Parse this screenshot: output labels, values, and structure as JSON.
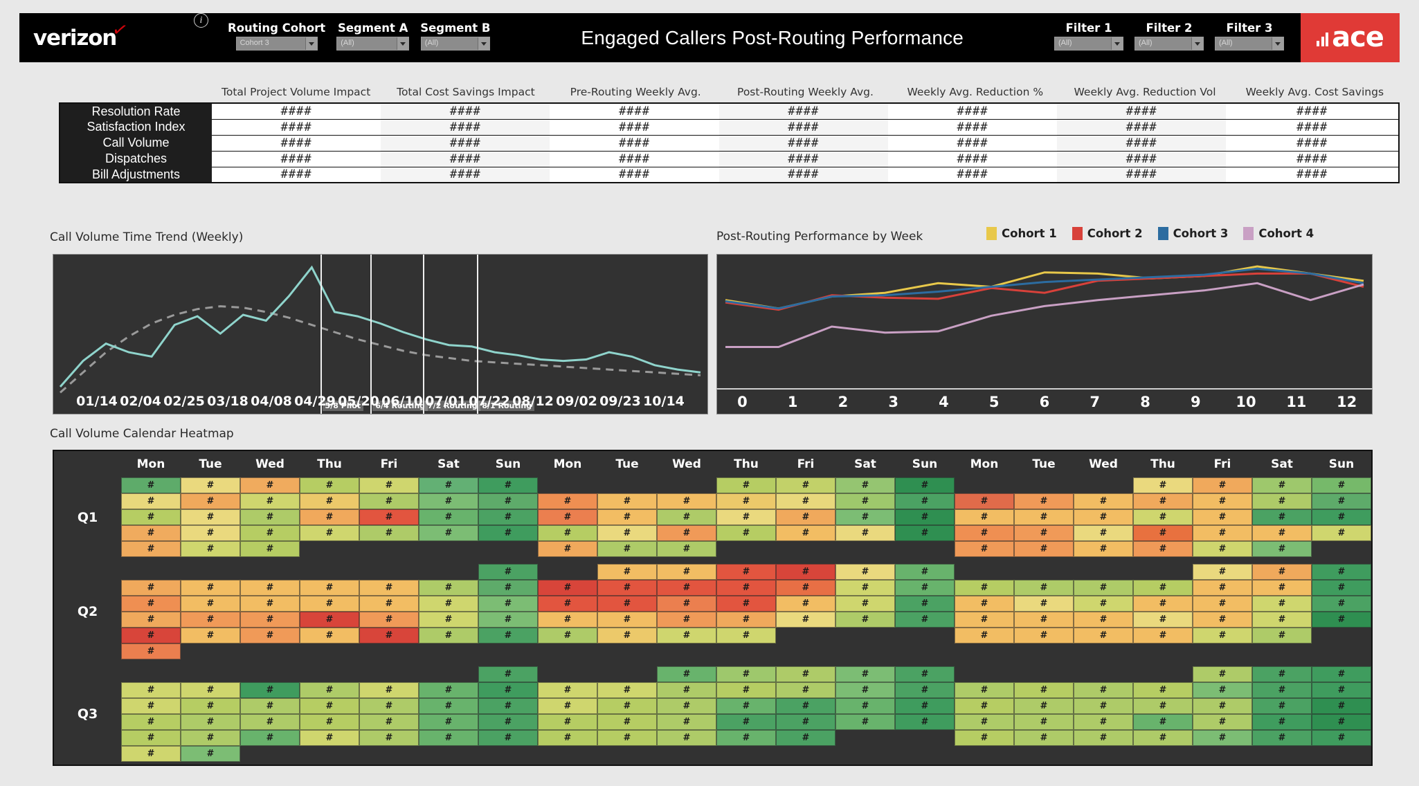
{
  "header": {
    "brand": "verizon",
    "brand_check": "✓",
    "info_icon": "info-icon",
    "title": "Engaged Callers Post-Routing Performance",
    "ace_logo_text": "ace",
    "left_filters": [
      {
        "label": "Routing Cohort",
        "value": "Cohort 3",
        "width_class": "fc-w1"
      },
      {
        "label": "Segment A",
        "value": "(All)",
        "width_class": "fc-w2"
      },
      {
        "label": "Segment B",
        "value": "(All)",
        "width_class": "fc-w3"
      }
    ],
    "right_filters": [
      {
        "label": "Filter 1",
        "value": "(All)",
        "width_class": "fc-w3"
      },
      {
        "label": "Filter 2",
        "value": "(All)",
        "width_class": "fc-w3"
      },
      {
        "label": "Filter 3",
        "value": "(All)",
        "width_class": "fc-w3"
      }
    ]
  },
  "kpi_matrix": {
    "columns": [
      "Total Project Volume Impact",
      "Total Cost Savings Impact",
      "Pre-Routing Weekly Avg.",
      "Post-Routing Weekly Avg.",
      "Weekly Avg. Reduction %",
      "Weekly Avg. Reduction Vol",
      "Weekly Avg. Cost Savings"
    ],
    "rows": [
      {
        "label": "Resolution Rate",
        "values": [
          "####",
          "####",
          "####",
          "####",
          "####",
          "####",
          "####"
        ]
      },
      {
        "label": "Satisfaction Index",
        "values": [
          "####",
          "####",
          "####",
          "####",
          "####",
          "####",
          "####"
        ]
      },
      {
        "label": "Call Volume",
        "values": [
          "####",
          "####",
          "####",
          "####",
          "####",
          "####",
          "####"
        ]
      },
      {
        "label": "Dispatches",
        "values": [
          "####",
          "####",
          "####",
          "####",
          "####",
          "####",
          "####"
        ]
      },
      {
        "label": "Bill Adjustments",
        "values": [
          "####",
          "####",
          "####",
          "####",
          "####",
          "####",
          "####"
        ]
      }
    ]
  },
  "trend_chart": {
    "title": "Call Volume Time Trend (Weekly)",
    "reference_lines": [
      {
        "label": "5/8 Pilot",
        "x_pct": 40.8
      },
      {
        "label": "6/4 Routing",
        "x_pct": 48.5
      },
      {
        "label": "7/2 Routing",
        "x_pct": 56.5
      },
      {
        "label": "8/1 Routing",
        "x_pct": 64.8
      }
    ]
  },
  "cohort_chart": {
    "title": "Post-Routing Performance by Week",
    "legend": [
      {
        "name": "Cohort 1",
        "color": "#e8c84a"
      },
      {
        "name": "Cohort 2",
        "color": "#d8413a"
      },
      {
        "name": "Cohort 3",
        "color": "#2c6ca0"
      },
      {
        "name": "Cohort 4",
        "color": "#c9a0c4"
      }
    ]
  },
  "heatmap": {
    "title": "Call Volume Calendar Heatmap",
    "day_headers": [
      "Mon",
      "Tue",
      "Wed",
      "Thu",
      "Fri",
      "Sat",
      "Sun",
      "Mon",
      "Tue",
      "Wed",
      "Thu",
      "Fri",
      "Sat",
      "Sun",
      "Mon",
      "Tue",
      "Wed",
      "Thu",
      "Fri",
      "Sat",
      "Sun"
    ],
    "cell_label": "#",
    "quarters": [
      "Q1",
      "Q2",
      "Q3"
    ]
  },
  "chart_data": [
    {
      "type": "line",
      "title": "Call Volume Time Trend (Weekly)",
      "xlabel": "",
      "ylabel": "",
      "grid": false,
      "legend": "none",
      "x": [
        "01/14",
        "02/04",
        "02/25",
        "03/18",
        "04/08",
        "04/29",
        "05/20",
        "06/10",
        "07/01",
        "07/22",
        "08/12",
        "09/02",
        "09/23",
        "10/14"
      ],
      "tick_labels": [
        "01/14",
        "02/04",
        "02/25",
        "03/18",
        "04/08",
        "04/29",
        "05/20",
        "06/10",
        "07/01",
        "07/22",
        "08/12",
        "09/02",
        "09/23",
        "10/14"
      ],
      "annotations": [
        "5/8 Pilot",
        "6/4 Routing",
        "7/2 Routing",
        "8/1 Routing"
      ],
      "series": [
        {
          "name": "Call Volume",
          "color": "#8fd4cc",
          "values": [
            12,
            30,
            42,
            36,
            33,
            55,
            61,
            49,
            62,
            58,
            75,
            95,
            64,
            61,
            56,
            50,
            45,
            41,
            40,
            36,
            34,
            31,
            30,
            31,
            36,
            33,
            27,
            24,
            22
          ]
        },
        {
          "name": "Trend",
          "color": "#9a9a9a",
          "style": "dashed",
          "values": [
            8,
            22,
            36,
            47,
            56,
            62,
            66,
            68,
            67,
            64,
            60,
            55,
            50,
            45,
            41,
            37,
            34,
            32,
            30,
            29,
            28,
            27,
            26,
            25,
            24,
            23,
            22,
            21,
            20
          ]
        }
      ],
      "ylim": [
        0,
        100
      ]
    },
    {
      "type": "line",
      "title": "Post-Routing Performance by Week",
      "xlabel": "",
      "ylabel": "",
      "grid": false,
      "legend": "top-right",
      "x": [
        0,
        1,
        2,
        3,
        4,
        5,
        6,
        7,
        8,
        9,
        10,
        11,
        12
      ],
      "ylim": [
        0,
        100
      ],
      "series": [
        {
          "name": "Cohort 1",
          "color": "#e8c84a",
          "values": [
            68,
            61,
            71,
            74,
            82,
            79,
            91,
            90,
            86,
            88,
            96,
            90,
            84
          ]
        },
        {
          "name": "Cohort 2",
          "color": "#d8413a",
          "values": [
            66,
            60,
            72,
            70,
            69,
            78,
            74,
            84,
            86,
            88,
            90,
            90,
            79
          ]
        },
        {
          "name": "Cohort 3",
          "color": "#2c6ca0",
          "values": [
            67,
            61,
            71,
            72,
            75,
            79,
            83,
            85,
            87,
            89,
            94,
            90,
            82
          ]
        },
        {
          "name": "Cohort 4",
          "color": "#c9a0c4",
          "values": [
            29,
            29,
            46,
            41,
            42,
            55,
            63,
            68,
            72,
            76,
            82,
            68,
            81
          ]
        }
      ]
    },
    {
      "type": "heatmap",
      "title": "Call Volume Calendar Heatmap",
      "xlabel": "",
      "ylabel": "",
      "columns": [
        "Mon",
        "Tue",
        "Wed",
        "Thu",
        "Fri",
        "Sat",
        "Sun",
        "Mon",
        "Tue",
        "Wed",
        "Thu",
        "Fri",
        "Sat",
        "Sun",
        "Mon",
        "Tue",
        "Wed",
        "Thu",
        "Fri",
        "Sat",
        "Sun"
      ],
      "rows": [
        "Q1",
        "Q2",
        "Q3"
      ],
      "cell_text": "#",
      "blocks": [
        {
          "row_label": "Q1",
          "grid": [
            [
              "#5eab6a",
              "#ead97e",
              "#f0ab5e",
              "#b6cd63",
              "#cfd66e",
              "#63b074",
              "#3f9c5e",
              null,
              null,
              null,
              "#b6cd63",
              "#c2d169",
              "#95c571",
              "#2f8f51",
              null,
              null,
              null,
              "#ead97e",
              "#f0a95c",
              "#9ec86c",
              "#76b96a"
            ],
            [
              "#e8d87c",
              "#f0a95c",
              "#cfd66e",
              "#ecc96a",
              "#aecb68",
              "#7cbd74",
              "#5eab6a",
              "#ef8f52",
              "#f2bd63",
              "#f2bd63",
              "#ecc96a",
              "#e8d87c",
              "#9ec86c",
              "#4ba263",
              "#e06b4a",
              "#f09a58",
              "#f2bd63",
              "#f0a95c",
              "#f2bd63",
              "#aecb68",
              "#5eab6a"
            ],
            [
              "#b6cd63",
              "#ead97e",
              "#aecb68",
              "#f0a95c",
              "#e2553f",
              "#68b36c",
              "#4ba263",
              "#eb7f4f",
              "#f2bd63",
              "#aecb68",
              "#ead97e",
              "#f0a95c",
              "#7cbd74",
              "#2f8f51",
              "#f2bd63",
              "#f2bd63",
              "#f2bd63",
              "#cfd66e",
              "#f2bd63",
              "#4ba263",
              "#3f9c5e"
            ],
            [
              "#f0ab5e",
              "#ead97e",
              "#b6cd63",
              "#cfd66e",
              "#aecb68",
              "#7cbd74",
              "#3f9c5e",
              "#b6cd63",
              "#ead97e",
              "#f09a58",
              "#b6cd63",
              "#f2bd63",
              "#ead97e",
              "#2f8f51",
              "#ef8f52",
              "#f09a58",
              "#ead97e",
              "#e8713f",
              "#f2bd63",
              "#f2bd63",
              "#cfd66e"
            ],
            [
              "#f0ab5e",
              "#cfd66e",
              "#b6cd63",
              null,
              null,
              null,
              null,
              "#f0a95c",
              "#aecb68",
              "#aecb68",
              null,
              null,
              null,
              null,
              "#f09a58",
              "#f09a58",
              "#f2bd63",
              "#f09a58",
              "#cfd66e",
              "#7cbd74",
              null
            ]
          ]
        },
        {
          "row_label": "Q2",
          "grid": [
            [
              null,
              null,
              null,
              null,
              null,
              null,
              "#4ba263",
              null,
              "#f2bd63",
              "#f2bd63",
              "#e2553f",
              "#d8453a",
              "#ead97e",
              "#68b36c",
              null,
              null,
              null,
              null,
              "#ead97e",
              "#f0a95c",
              "#3f9c5e"
            ],
            [
              "#f0a95c",
              "#f2bd63",
              "#f2bd63",
              "#f2bd63",
              "#f2bd63",
              "#aecb68",
              "#5eab6a",
              "#d8453a",
              "#e2553f",
              "#e2553f",
              "#e2553f",
              "#e86f45",
              "#cfd66e",
              "#68b36c",
              "#b6cd63",
              "#aecb68",
              "#aecb68",
              "#b6cd63",
              "#f2bd63",
              "#f2bd63",
              "#3f9c5e"
            ],
            [
              "#ef8f52",
              "#f2bd63",
              "#f2bd63",
              "#f2bd63",
              "#f2bd63",
              "#cfd66e",
              "#7cbd74",
              "#e2553f",
              "#e2553f",
              "#eb7f4f",
              "#e2553f",
              "#f2bd63",
              "#cfd66e",
              "#4ba263",
              "#f2bd63",
              "#ead97e",
              "#cfd66e",
              "#f2bd63",
              "#f2bd63",
              "#cfd66e",
              "#4ba263"
            ],
            [
              "#f0a95c",
              "#f09a58",
              "#f09a58",
              "#d8453a",
              "#f09a58",
              "#cfd66e",
              "#7cbd74",
              "#f2bd63",
              "#f2bd63",
              "#f09a58",
              "#f0a95c",
              "#ead97e",
              "#aecb68",
              "#4ba263",
              "#f2bd63",
              "#f2bd63",
              "#f2bd63",
              "#ead97e",
              "#f2bd63",
              "#cfd66e",
              "#2f8f51"
            ],
            [
              "#d8453a",
              "#f2bd63",
              "#f09a58",
              "#f2bd63",
              "#d8453a",
              "#aecb68",
              "#4ba263",
              "#aecb68",
              "#ecc96a",
              "#cfd66e",
              "#cfd66e",
              null,
              null,
              null,
              "#f2bd63",
              "#f2bd63",
              "#f2bd63",
              "#f2bd63",
              "#cfd66e",
              "#aecb68",
              null
            ],
            [
              "#eb7f4f",
              null,
              null,
              null,
              null,
              null,
              null,
              null,
              null,
              null,
              null,
              null,
              null,
              null,
              null,
              null,
              null,
              null,
              null,
              null,
              null
            ]
          ]
        },
        {
          "row_label": "Q3",
          "grid": [
            [
              null,
              null,
              null,
              null,
              null,
              null,
              "#4ba263",
              null,
              null,
              "#68b36c",
              "#9ec86c",
              "#aecb68",
              "#7cbd74",
              "#4ba263",
              null,
              null,
              null,
              null,
              "#aecb68",
              "#4ba263",
              "#3f9c5e"
            ],
            [
              "#cfd66e",
              "#cfd66e",
              "#3f9c5e",
              "#aecb68",
              "#cfd66e",
              "#68b36c",
              "#3f9c5e",
              "#cfd66e",
              "#cfd66e",
              "#aecb68",
              "#b6cd63",
              "#aecb68",
              "#7cbd74",
              "#4ba263",
              "#aecb68",
              "#b6cd63",
              "#aecb68",
              "#b6cd63",
              "#7cbd74",
              "#4ba263",
              "#3f9c5e"
            ],
            [
              "#cfd66e",
              "#b6cd63",
              "#aecb68",
              "#b6cd63",
              "#aecb68",
              "#68b36c",
              "#4ba263",
              "#cfd66e",
              "#b6cd63",
              "#aecb68",
              "#68b36c",
              "#4ba263",
              "#68b36c",
              "#3f9c5e",
              "#b6cd63",
              "#aecb68",
              "#aecb68",
              "#aecb68",
              "#aecb68",
              "#4ba263",
              "#2f8f51"
            ],
            [
              "#b6cd63",
              "#aecb68",
              "#aecb68",
              "#b6cd63",
              "#aecb68",
              "#68b36c",
              "#4ba263",
              "#b6cd63",
              "#b6cd63",
              "#aecb68",
              "#4ba263",
              "#4ba263",
              "#68b36c",
              "#3f9c5e",
              "#aecb68",
              "#aecb68",
              "#aecb68",
              "#68b36c",
              "#aecb68",
              "#3f9c5e",
              "#2f8f51"
            ],
            [
              "#b6cd63",
              "#aecb68",
              "#68b36c",
              "#cfd66e",
              "#aecb68",
              "#68b36c",
              "#4ba263",
              "#b6cd63",
              "#b6cd63",
              "#aecb68",
              "#68b36c",
              "#4ba263",
              null,
              null,
              "#b6cd63",
              "#aecb68",
              "#aecb68",
              "#aecb68",
              "#7cbd74",
              "#4ba263",
              "#3f9c5e"
            ],
            [
              "#cfd66e",
              "#7cbd74",
              null,
              null,
              null,
              null,
              null,
              null,
              null,
              null,
              null,
              null,
              null,
              null,
              null,
              null,
              null,
              null,
              null,
              null,
              null
            ]
          ]
        }
      ]
    }
  ]
}
